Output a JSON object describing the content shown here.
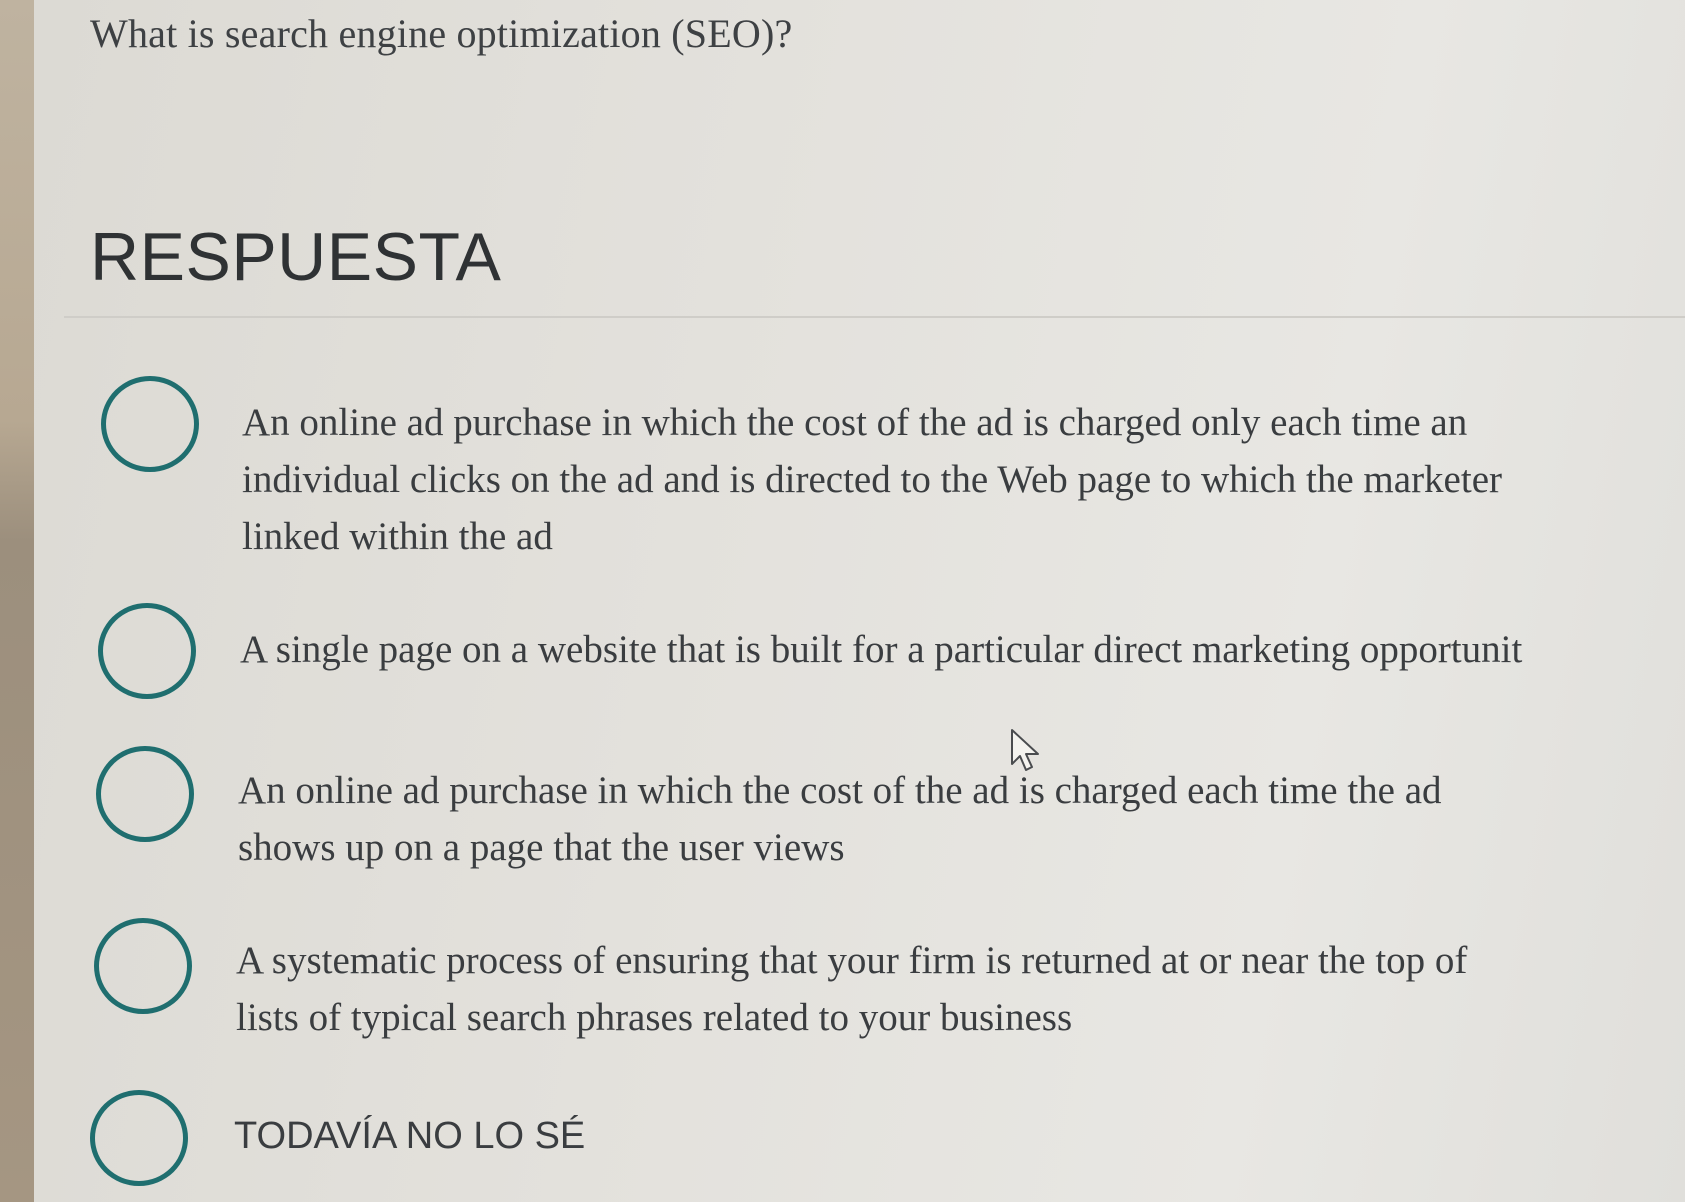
{
  "question": "What is search engine optimization (SEO)?",
  "heading": "RESPUESTA",
  "options": [
    {
      "lines": [
        "An online ad purchase in which the cost of the ad is charged only each time an",
        "individual clicks on the ad and is directed to the Web page to which the marketer",
        "linked within the ad"
      ]
    },
    {
      "lines": [
        "A single page on a website that is built for a particular direct marketing opportunit"
      ]
    },
    {
      "lines": [
        "An online ad purchase in which the cost of the ad is charged each time the ad",
        "shows up on a page that the user views"
      ]
    },
    {
      "lines": [
        "A systematic process of ensuring that your firm is returned at or near the top of",
        "lists of typical search phrases related to your business"
      ]
    },
    {
      "lines": [
        "TODAVÍA NO LO SÉ"
      ]
    }
  ],
  "colors": {
    "radio_border": "#1f6e6f",
    "text": "#3a3d40"
  },
  "icons": {
    "cursor": "mouse-pointer-icon"
  }
}
